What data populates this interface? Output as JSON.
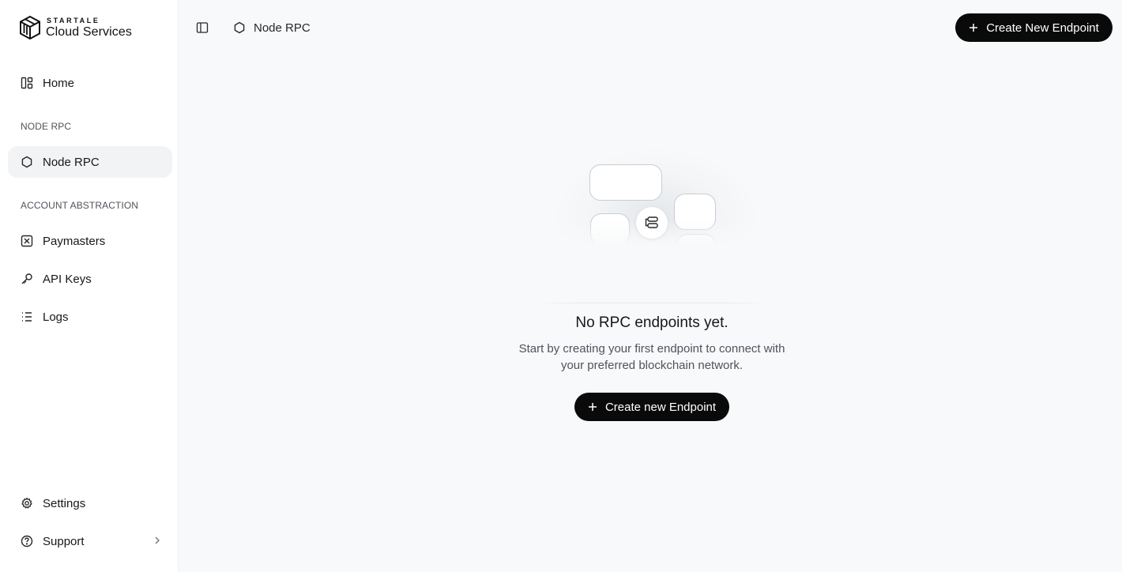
{
  "brand": {
    "company": "STARTALE",
    "product": "Cloud Services"
  },
  "sidebar": {
    "home": {
      "label": "Home",
      "icon": "dashboard-icon"
    },
    "sections": [
      {
        "title": "NODE RPC",
        "items": [
          {
            "label": "Node RPC",
            "icon": "hexagon-icon",
            "active": true
          }
        ]
      },
      {
        "title": "ACCOUNT ABSTRACTION",
        "items": [
          {
            "label": "Paymasters",
            "icon": "paymaster-icon"
          },
          {
            "label": "API Keys",
            "icon": "key-icon"
          },
          {
            "label": "Logs",
            "icon": "list-icon"
          }
        ]
      }
    ],
    "footer": {
      "settings": {
        "label": "Settings",
        "icon": "gear-icon"
      },
      "support": {
        "label": "Support",
        "icon": "help-circle-icon"
      }
    }
  },
  "header": {
    "breadcrumb": "Node RPC",
    "create_button": "Create New Endpoint"
  },
  "empty_state": {
    "title": "No RPC endpoints yet.",
    "description_line1": "Start by creating your first endpoint to connect with",
    "description_line2": "your preferred blockchain network.",
    "button": "Create new Endpoint"
  },
  "colors": {
    "background": "#f7f9fa",
    "sidebar": "#ffffff",
    "primary_button": "#0a0a0a",
    "active_item": "#f1f3f5"
  }
}
